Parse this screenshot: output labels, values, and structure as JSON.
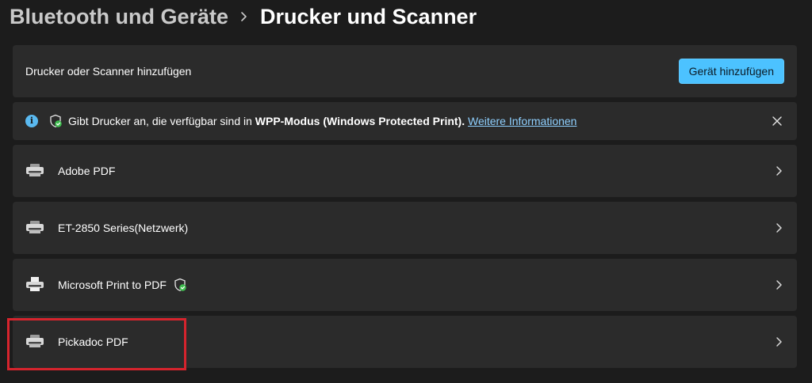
{
  "breadcrumb": {
    "parent": "Bluetooth und Geräte",
    "current": "Drucker und Scanner"
  },
  "add_device": {
    "label": "Drucker oder Scanner hinzufügen",
    "button_label": "Gerät hinzufügen"
  },
  "info_bar": {
    "text_prefix": "Gibt Drucker an, die verfügbar sind in ",
    "text_bold": "WPP-Modus (Windows Protected Print).",
    "link_text": "Weitere Informationen"
  },
  "printers": [
    {
      "name": "Adobe PDF",
      "icon": "printer-icon",
      "protected": false
    },
    {
      "name": "ET-2850 Series(Netzwerk)",
      "icon": "printer-icon",
      "protected": false
    },
    {
      "name": "Microsoft Print to PDF",
      "icon": "printer-pdf-icon",
      "protected": true
    },
    {
      "name": "Pickadoc PDF",
      "icon": "printer-icon",
      "protected": false
    }
  ],
  "colors": {
    "background": "#1c1c1c",
    "card": "#2b2b2b",
    "accent_button": "#4cc2ff",
    "link": "#8fd0ff",
    "info_icon": "#5ab9f0",
    "shield_check": "#3fbf4f",
    "highlight": "#d6242d"
  }
}
